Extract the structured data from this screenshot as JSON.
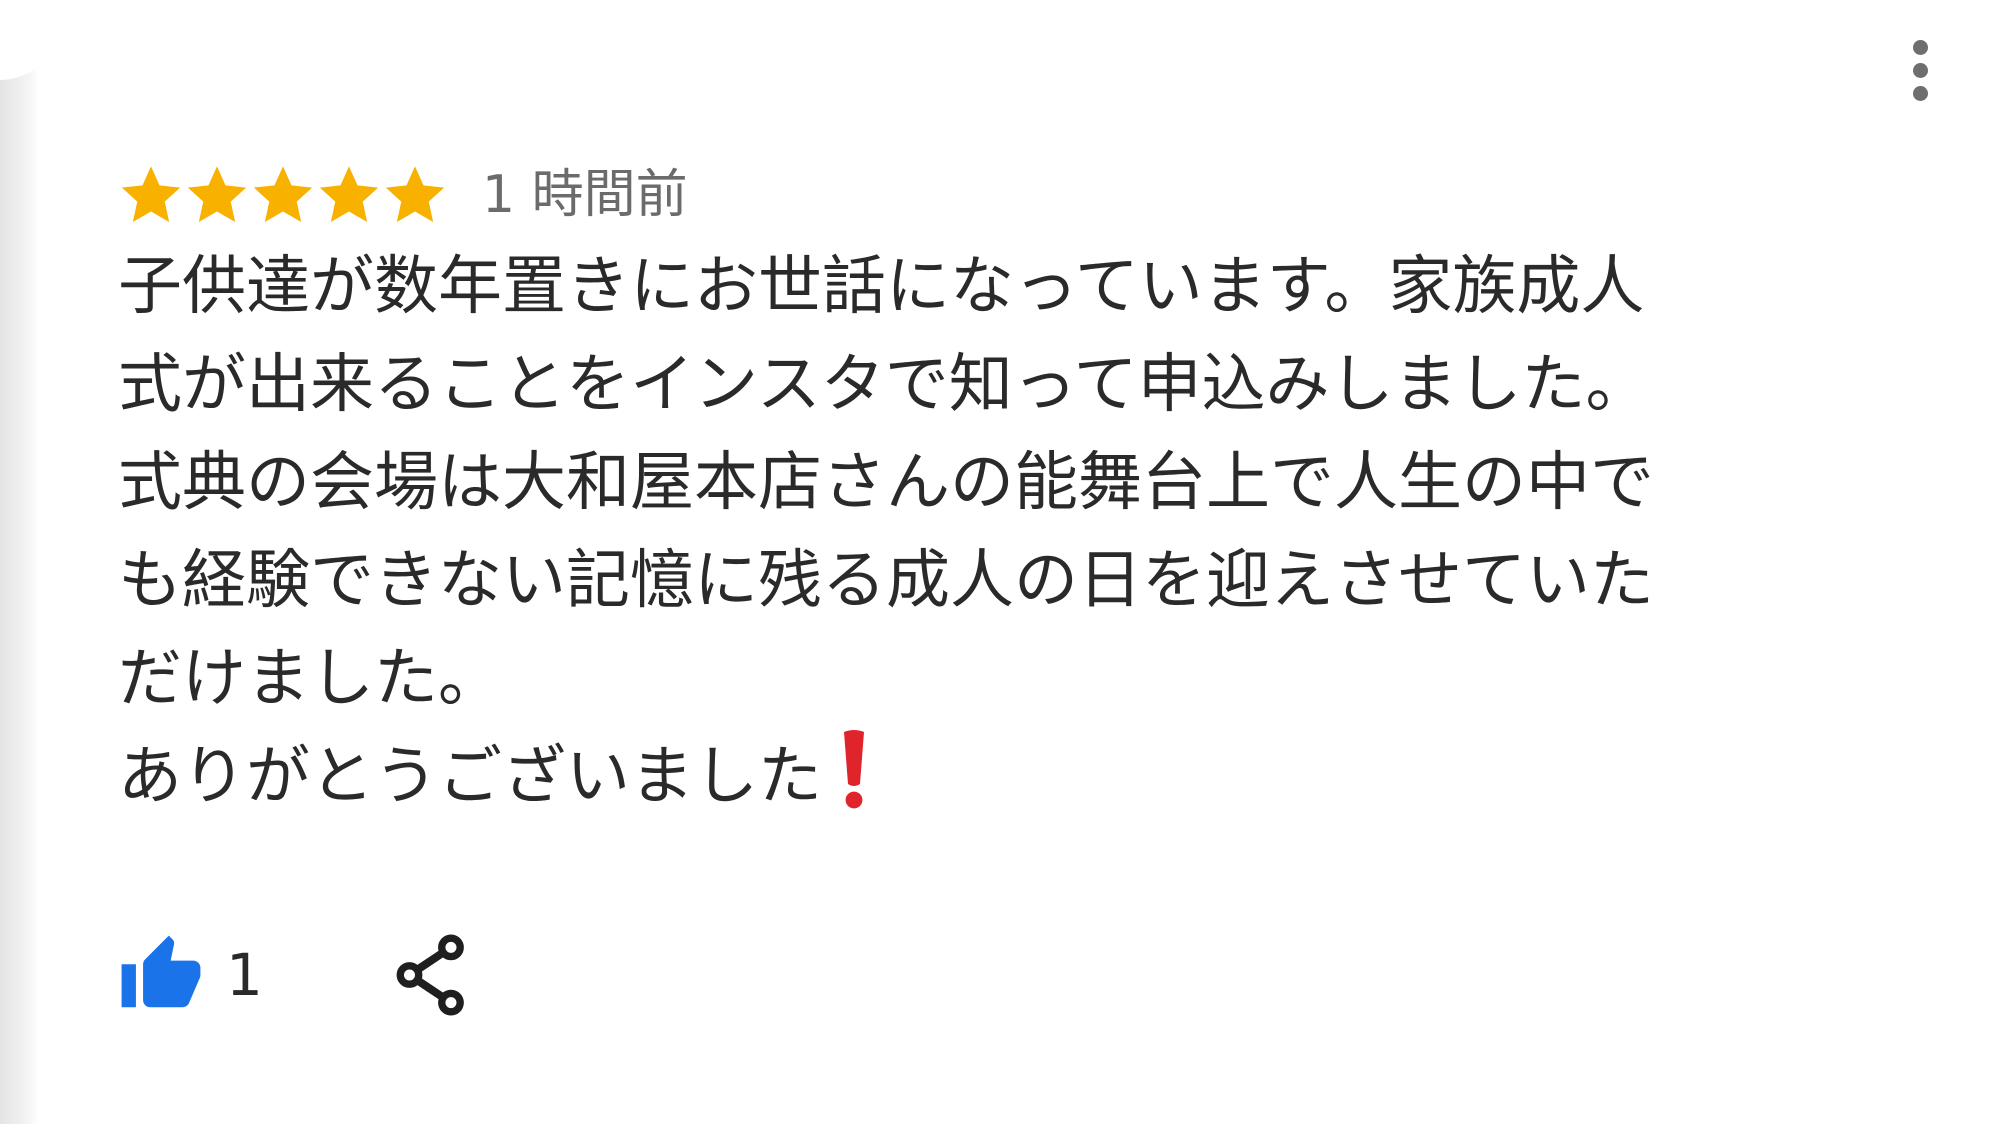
{
  "review": {
    "rating": 5,
    "rating_max": 5,
    "timestamp": "1 時間前",
    "lines": [
      "子供達が数年置きにお世話になっています。家族成人",
      "式が出来ることをインスタで知って申込みしました。",
      "式典の会場は大和屋本店さんの能舞台上で人生の中で",
      "も経験できない記憶に残る成人の日を迎えさせていた",
      "だけました。",
      "ありがとうございました"
    ],
    "trailing_emoji": "❗"
  },
  "actions": {
    "like_count": "1",
    "like_icon": "thumbs-up-icon",
    "share_icon": "share-icon",
    "more_icon": "more-vert-icon"
  },
  "colors": {
    "star": "#F9B100",
    "like": "#1A73E8",
    "text": "#2A2A2A",
    "muted": "#6B6B6B",
    "exclaim": "#E0242B"
  }
}
